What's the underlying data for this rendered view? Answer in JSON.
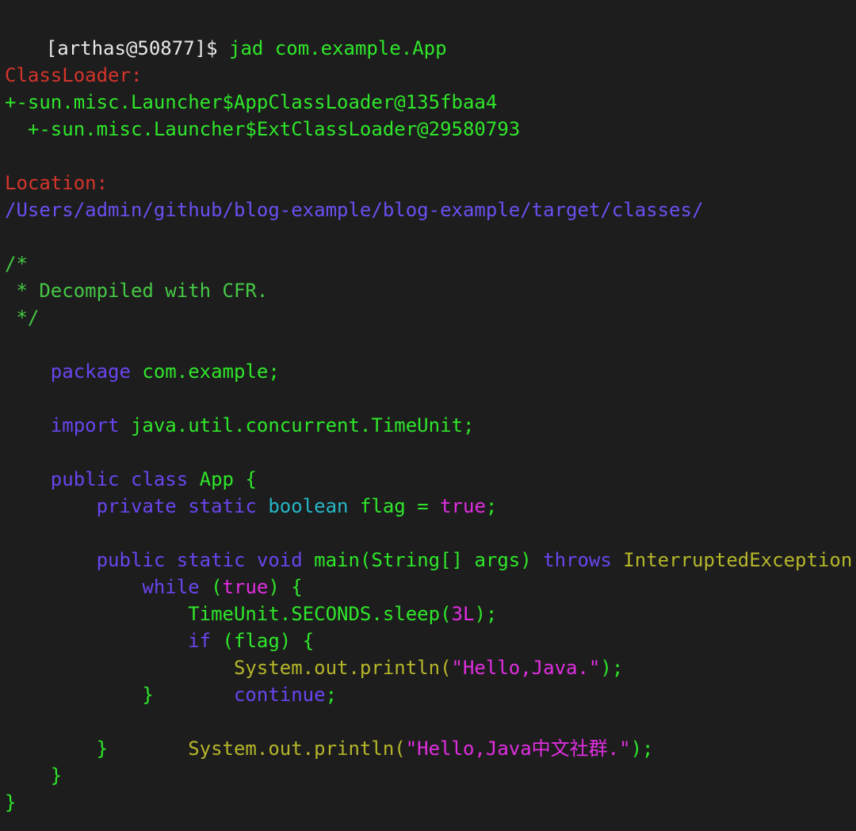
{
  "prompt": {
    "bracket": "[",
    "user_host": "[arthas@50877]$",
    "command": "jad com.example.App"
  },
  "classloader": {
    "label": "ClassLoader:",
    "lines": [
      "+-sun.misc.Launcher$AppClassLoader@135fbaa4",
      "  +-sun.misc.Launcher$ExtClassLoader@29580793"
    ]
  },
  "location": {
    "label": "Location:",
    "path": "/Users/admin/github/blog-example/blog-example/target/classes/"
  },
  "code": {
    "comment_open": "/*",
    "comment_body": " * Decompiled with CFR.",
    "comment_close": " */",
    "package_kw": "package",
    "package_name": " com.example;",
    "import_kw": "import",
    "import_name": " java.util.concurrent.TimeUnit;",
    "class_kw1": "public",
    "class_kw2": " class",
    "class_name": " App {",
    "field_indent": "    ",
    "field_kw1": "private",
    "field_kw2": " static",
    "field_type": " boolean",
    "field_name": " flag =",
    "field_value": " true",
    "field_end": ";",
    "main_indent": "    ",
    "main_kw1": "public",
    "main_kw2": " static",
    "main_kw3": " void",
    "main_sig": " main(String[] args)",
    "main_throws": " throws",
    "main_exc": " InterruptedException",
    "main_brace": " {",
    "while_indent": "        ",
    "while_kw": "while",
    "while_open": " (",
    "while_true": "true",
    "while_close": ") {",
    "sleep_indent": "            ",
    "sleep_pre": "TimeUnit.SECONDS.sleep(",
    "sleep_arg": "3L",
    "sleep_end": ");",
    "if_indent": "            ",
    "if_kw": "if",
    "if_cond": " (flag) {",
    "print1_indent": "                ",
    "print1_pre": "System.out.println(",
    "print1_str": "\"Hello,Java.\"",
    "print1_end": ");",
    "cont_indent": "                ",
    "cont_kw": "continue",
    "cont_end": ";",
    "if_close": "            }",
    "print2_indent": "            ",
    "print2_pre": "System.out.println(",
    "print2_str": "\"Hello,Java中文社群.\"",
    "print2_end": ");",
    "while_close_brace": "        }",
    "main_close_brace": "    }",
    "class_close_brace": "}"
  },
  "colors": {
    "background": "#1d1d1d",
    "prompt": "#2fe62a",
    "label": "#d4352c",
    "path": "#6a4ff0",
    "comment": "#45c845",
    "keyword": "#6a45ee",
    "type": "#25b7c8",
    "literal": "#e02ee0",
    "identifier": "#b5b62a"
  }
}
